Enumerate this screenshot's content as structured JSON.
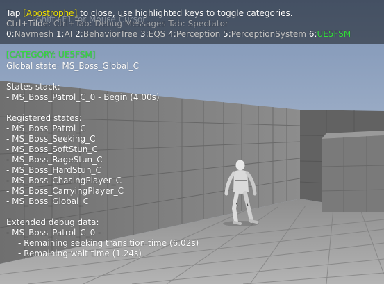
{
  "hint": {
    "tap_prefix": "Tap ",
    "tap_key": "[Apostrophe]",
    "tap_suffix": " to close, use highlighted keys to toggle categories.",
    "line2": "Ctrl+Tilde: ",
    "line2_ghost": "Shift+F1 for Mouse Cursor",
    "line2_more": "Ctrl+Tab: Debug Messages  Tab: Spectator"
  },
  "categories": [
    {
      "key": "0:",
      "label": "Navmesh"
    },
    {
      "key": "1:",
      "label": "AI"
    },
    {
      "key": "2:",
      "label": "BehaviorTree"
    },
    {
      "key": "3:",
      "label": "EQS"
    },
    {
      "key": "4:",
      "label": "Perception"
    },
    {
      "key": "5:",
      "label": "PerceptionSystem"
    },
    {
      "key": "6:",
      "label": "UE5FSM"
    }
  ],
  "fsm": {
    "category_header": "[CATEGORY: UE5FSM]",
    "global_state": "Global state: MS_Boss_Global_C",
    "states_stack_title": "States stack:",
    "states_stack": [
      "- MS_Boss_Patrol_C_0 - Begin (4.00s)"
    ],
    "registered_title": "Registered states:",
    "registered": [
      "- MS_Boss_Patrol_C",
      "- MS_Boss_Seeking_C",
      "- MS_Boss_SoftStun_C",
      "- MS_Boss_RageStun_C",
      "- MS_Boss_HardStun_C",
      "- MS_Boss_ChasingPlayer_C",
      "- MS_Boss_CarryingPlayer_C",
      "- MS_Boss_Global_C"
    ],
    "extended_title": "Extended debug data:",
    "extended_state": "- MS_Boss_Patrol_C_0 -",
    "extended_items": [
      "- Remaining seeking transition time (6.02s)",
      "- Remaining wait time (1.24s)"
    ]
  },
  "colors": {
    "highlight_yellow": "#f2e300",
    "active_green": "#34e13c",
    "text_white": "#ffffff"
  }
}
